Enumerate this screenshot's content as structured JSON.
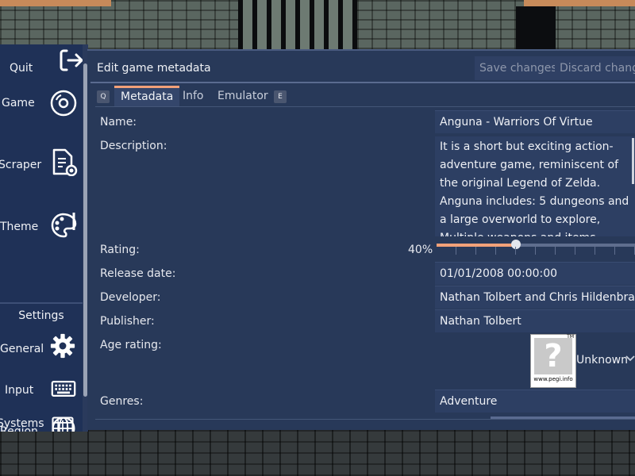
{
  "sidebar": {
    "items": [
      {
        "label": "Quit",
        "icon": "exit-icon"
      },
      {
        "label": "Game",
        "icon": "disc-icon"
      },
      {
        "label": "Scraper",
        "icon": "document-search-icon"
      },
      {
        "label": "Theme",
        "icon": "palette-icon"
      }
    ],
    "settings_header": "Settings",
    "settings_items": [
      {
        "label": "General",
        "icon": "gear-icon"
      },
      {
        "label": "Input",
        "icon": "keyboard-icon"
      },
      {
        "label": "Region",
        "icon": "globe-icon"
      },
      {
        "label": "Systems",
        "icon": "sliders-icon"
      }
    ]
  },
  "panel": {
    "title": "Edit game metadata",
    "save_label": "Save changes",
    "discard_label": "Discard changes",
    "tabs": [
      {
        "label": "Metadata",
        "active": true
      },
      {
        "label": "Info",
        "active": false
      },
      {
        "label": "Emulator",
        "active": false
      }
    ],
    "tab_hint_left": "Q",
    "tab_hint_right": "E"
  },
  "fields": {
    "name_label": "Name:",
    "name_value": "Anguna - Warriors Of Virtue",
    "description_label": "Description:",
    "description_value": "It is a short but exciting action-adventure game, reminiscent of the original Legend of Zelda.\nAnguna includes: 5 dungeons and a large overworld to explore, Multiple weapons and items including: a",
    "rating_label": "Rating:",
    "rating_percent": "40%",
    "rating_fraction": 0.4,
    "release_label": "Release date:",
    "release_value": "01/01/2008 00:00:00",
    "developer_label": "Developer:",
    "developer_value": "Nathan Tolbert and Chris Hildenbrand",
    "publisher_label": "Publisher:",
    "publisher_value": "Nathan Tolbert",
    "age_label": "Age rating:",
    "age_value": "Unknown",
    "pegi_mark": "?",
    "pegi_site": "www.pegi.info",
    "pegi_tm": "TM",
    "genres_label": "Genres:",
    "genres_value": "Adventure"
  },
  "colors": {
    "panel_bg": "#283959",
    "sidebar_bg": "#1f3157",
    "accent": "#f2a179"
  }
}
